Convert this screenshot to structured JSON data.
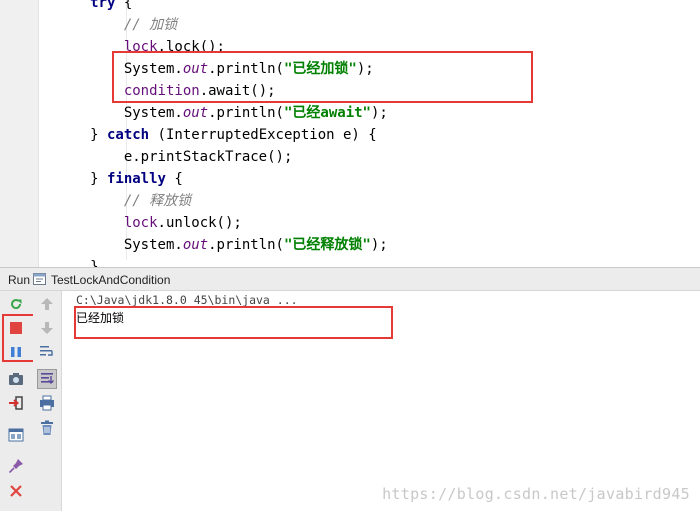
{
  "editor": {
    "lines": [
      [
        {
          "t": "    "
        },
        {
          "t": "try",
          "c": "kw"
        },
        {
          "t": " {"
        }
      ],
      [
        {
          "t": "        "
        },
        {
          "t": "// 加锁",
          "c": "com"
        }
      ],
      [
        {
          "t": "        "
        },
        {
          "t": "lock",
          "c": "fld"
        },
        {
          "t": ".lock();"
        }
      ],
      [
        {
          "t": "        System."
        },
        {
          "t": "out",
          "c": "sfld"
        },
        {
          "t": ".println("
        },
        {
          "t": "\"已经加锁\"",
          "c": "str"
        },
        {
          "t": ");"
        }
      ],
      [
        {
          "t": "        "
        },
        {
          "t": "condition",
          "c": "fld"
        },
        {
          "t": ".await();"
        }
      ],
      [
        {
          "t": "        System."
        },
        {
          "t": "out",
          "c": "sfld"
        },
        {
          "t": ".println("
        },
        {
          "t": "\"已经await\"",
          "c": "str"
        },
        {
          "t": ");"
        }
      ],
      [
        {
          "t": "    } "
        },
        {
          "t": "catch",
          "c": "kw"
        },
        {
          "t": " (InterruptedException e) {"
        }
      ],
      [
        {
          "t": "        e.printStackTrace();"
        }
      ],
      [
        {
          "t": "    } "
        },
        {
          "t": "finally",
          "c": "kw"
        },
        {
          "t": " {"
        }
      ],
      [
        {
          "t": "        "
        },
        {
          "t": "// 释放锁",
          "c": "com"
        }
      ],
      [
        {
          "t": "        "
        },
        {
          "t": "lock",
          "c": "fld"
        },
        {
          "t": ".unlock();"
        }
      ],
      [
        {
          "t": "        System."
        },
        {
          "t": "out",
          "c": "sfld"
        },
        {
          "t": ".println("
        },
        {
          "t": "\"已经释放锁\"",
          "c": "str"
        },
        {
          "t": ");"
        }
      ],
      [
        {
          "t": "    }"
        }
      ]
    ]
  },
  "run_panel": {
    "tab_label": "Run",
    "config_name": "TestLockAndCondition",
    "command_line": "C:\\Java\\jdk1.8.0_45\\bin\\java ...",
    "output_lines": [
      "已经加锁"
    ]
  },
  "toolbar_left": [
    {
      "icon": "rerun-icon"
    },
    {
      "icon": "stop-icon"
    },
    {
      "icon": "pause-icon"
    },
    {
      "icon": "dump-threads-icon"
    },
    {
      "icon": "exit-icon"
    },
    {
      "icon": "restore-layout-icon"
    },
    {
      "icon": "pin-icon"
    },
    {
      "icon": "close-icon"
    }
  ],
  "toolbar_right": [
    {
      "icon": "up-arrow-icon"
    },
    {
      "icon": "down-arrow-icon"
    },
    {
      "icon": "soft-wrap-icon"
    },
    {
      "icon": "scroll-to-end-icon"
    },
    {
      "icon": "print-icon"
    },
    {
      "icon": "clear-all-icon"
    }
  ],
  "colors": {
    "keyword": "#000080",
    "comment": "#808080",
    "field": "#660e7a",
    "string": "#008000",
    "highlight": "#e53935"
  },
  "watermark": "https://blog.csdn.net/javabird945"
}
